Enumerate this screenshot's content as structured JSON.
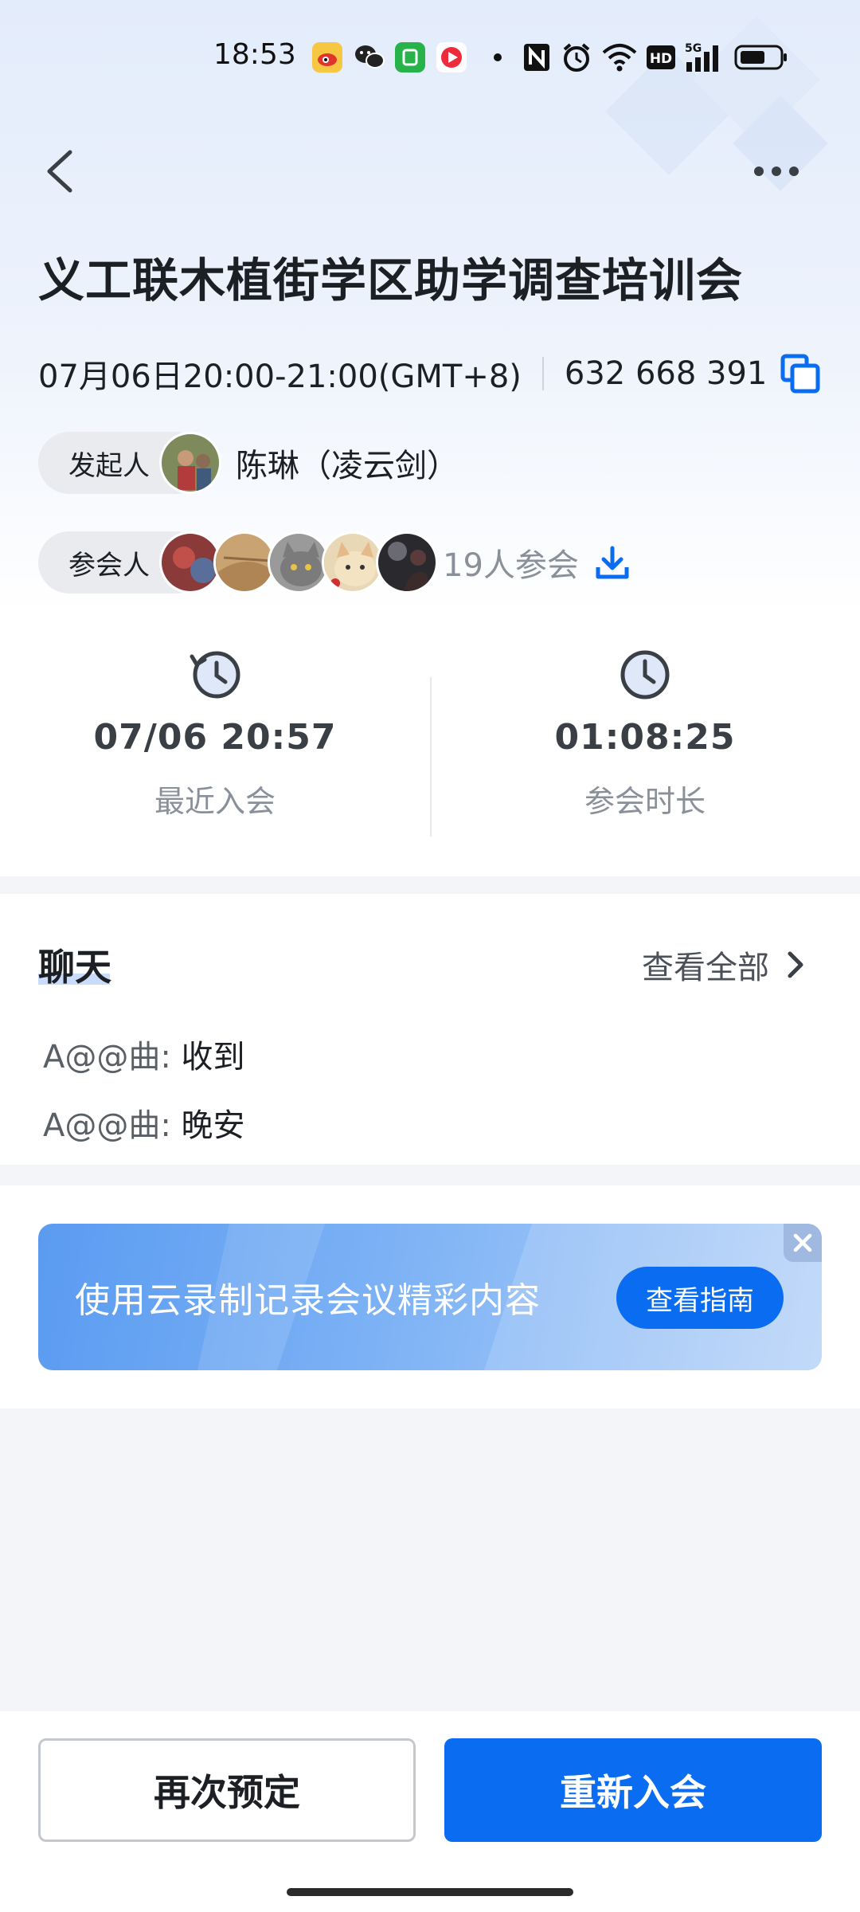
{
  "status_bar": {
    "time": "18:53",
    "icons": [
      "weibo-icon",
      "wechat-icon",
      "green-app-icon",
      "video-app-icon",
      "dot-icon",
      "nfc-icon",
      "alarm-icon",
      "wifi-icon",
      "hd-icon",
      "signal-5g-icon",
      "battery-icon"
    ]
  },
  "header": {
    "back_icon": "chevron-left-icon",
    "more_icon": "more-dots-icon"
  },
  "meeting": {
    "title": "义工联木植街学区助学调查培训会",
    "time_range": "07月06日20:00-21:00(GMT+8)",
    "meeting_id": "632 668 391",
    "host_label": "发起人",
    "host_name": "陈琳（凌云剑）",
    "attendee_label": "参会人",
    "attendee_count": "19人参会"
  },
  "stats": {
    "last_join_value": "07/06 20:57",
    "last_join_label": "最近入会",
    "duration_value": "01:08:25",
    "duration_label": "参会时长"
  },
  "chat": {
    "title": "聊天",
    "view_all": "查看全部",
    "messages": [
      {
        "sender": "A@@曲:",
        "text": " 收到"
      },
      {
        "sender": "A@@曲:",
        "text": " 晚安"
      }
    ]
  },
  "banner": {
    "text": "使用云录制记录会议精彩内容",
    "button": "查看指南"
  },
  "bottom": {
    "reschedule": "再次预定",
    "rejoin": "重新入会"
  },
  "colors": {
    "accent": "#0a6cf0",
    "text_primary": "#1c1f23",
    "text_secondary": "#8a9099"
  }
}
